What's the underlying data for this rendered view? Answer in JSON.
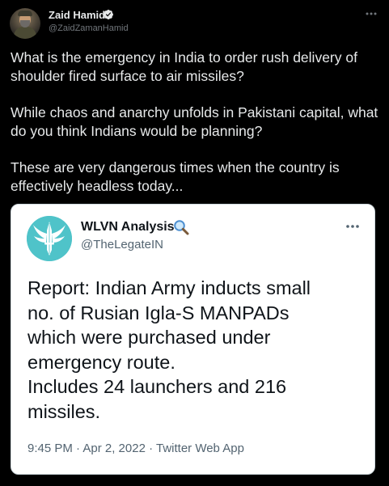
{
  "tweet": {
    "author": {
      "name": "Zaid Hamid",
      "handle": "@ZaidZamanHamid",
      "verified": true
    },
    "more_icon": "more-horizontal-icon",
    "paragraphs": [
      "What is the emergency in India to order rush delivery of shoulder fired surface to air missiles?",
      "While chaos and anarchy unfolds in Pakistani capital, what do you think Indians would be planning?",
      "These are very dangerous times when the country is effectively headless today..."
    ]
  },
  "quoted_tweet": {
    "author": {
      "name": "WLVN Analysis",
      "name_emoji": "left-pointing-magnifying-glass-icon",
      "handle": "@TheLegateIN"
    },
    "more_icon": "more-horizontal-icon",
    "text_lines": [
      "Report: Indian Army inducts small",
      "no. of Rusian Igla-S MANPADs",
      "which were purchased under",
      "emergency route.",
      "Includes 24 launchers and 216",
      "missiles."
    ],
    "meta": "9:45 PM · Apr 2, 2022 · Twitter Web App"
  },
  "colors": {
    "background": "#000000",
    "primary_text_dark": "#e7e9ea",
    "secondary_text_dark": "#71767b",
    "card_background": "#ffffff",
    "primary_text_light": "#0f1419",
    "secondary_text_light": "#536471",
    "verified_blue": "#1d9bf0",
    "avatar_teal": "#4fc3c9"
  }
}
